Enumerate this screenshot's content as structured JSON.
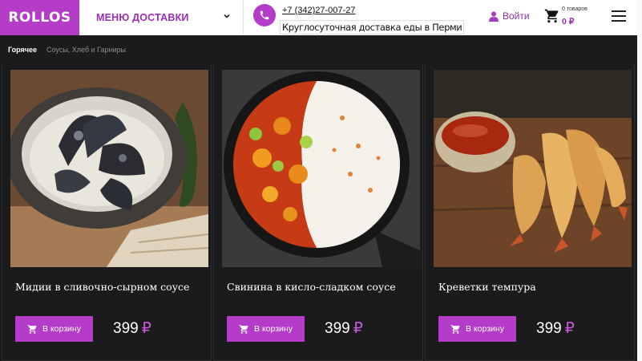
{
  "header": {
    "logo": "ROLLOS",
    "menu_label": "МЕНЮ ДОСТАВКИ",
    "phone": "+7 (342)27-007-27",
    "phone_subtitle": "Круглосуточная доставка еды в Перми",
    "login": "Войти",
    "cart_count": "0 товаров",
    "cart_sum": "0 ₽"
  },
  "categories": [
    "Горячее",
    "Соусы, Хлеб и Гарниры"
  ],
  "products": [
    {
      "title": "Мидии в сливочно-сырном соусе",
      "button": "В корзину",
      "price": "399",
      "currency": "₽"
    },
    {
      "title": "Свинина в кисло-сладком соусе",
      "button": "В корзину",
      "price": "399",
      "currency": "₽"
    },
    {
      "title": "Креветки темпура",
      "button": "В корзину",
      "price": "399",
      "currency": "₽"
    }
  ],
  "colors": {
    "accent": "#b43cc9",
    "background": "#1b1b1d",
    "header": "#ffffff"
  }
}
